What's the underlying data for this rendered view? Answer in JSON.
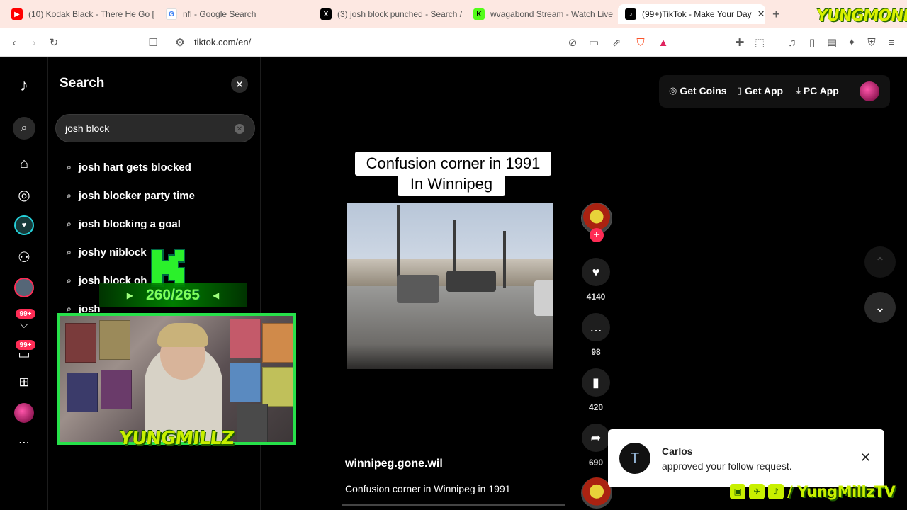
{
  "browser": {
    "tabs": [
      {
        "title": "(10) Kodak Black - There He Go [O",
        "favicon_color": "#ff0000"
      },
      {
        "title": "nfl - Google Search",
        "favicon_color": "#4285f4"
      },
      {
        "title": "(3) josh block punched - Search /",
        "favicon_color": "#000000"
      },
      {
        "title": "wvagabond Stream - Watch Live",
        "favicon_color": "#53fc18"
      },
      {
        "title": "(99+)TikTok - Make Your Day",
        "favicon_color": "#000000"
      }
    ],
    "url": "tiktok.com/en/",
    "brand_logo_text": "YUNGMONEY"
  },
  "search": {
    "title": "Search",
    "query": "josh block",
    "suggestions": [
      "josh hart gets blocked",
      "josh blocker party time",
      "josh blocking a goal",
      "joshy niblock",
      "josh block oh",
      "josh"
    ]
  },
  "rail": {
    "badge_1": "99+",
    "badge_2": "99+"
  },
  "stream": {
    "goal_text": "260/265",
    "streamer_name": "YUNGMILLZ",
    "socials_text": "/ YungMillzTV"
  },
  "header": {
    "get_coins": "Get Coins",
    "get_app": "Get App",
    "pc_app": "PC App"
  },
  "video": {
    "caption_line1": "Confusion corner in 1991",
    "caption_line2": "In Winnipeg",
    "likes": "4140",
    "comments": "98",
    "saves": "420",
    "shares": "690",
    "username": "winnipeg.gone.wil",
    "description": "Confusion corner in Winnipeg in 1991"
  },
  "toast": {
    "name": "Carlos",
    "message": "approved your follow request."
  },
  "colors": {
    "accent": "#fe2c55",
    "stream_green": "#27e14a",
    "brand_yellow": "#c8f000"
  }
}
